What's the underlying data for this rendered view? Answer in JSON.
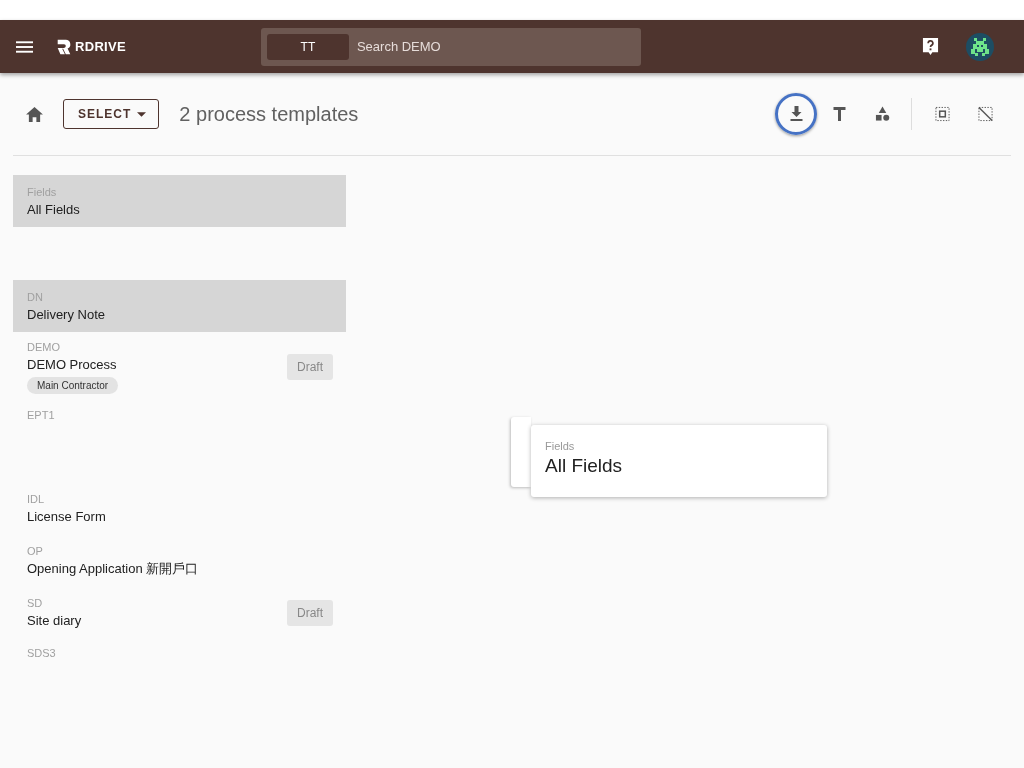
{
  "header": {
    "brand": "RDRIVE",
    "search": {
      "scope": "TT",
      "placeholder": "Search DEMO"
    }
  },
  "toolbar": {
    "select_label": "SELECT",
    "count_title": "2 process templates",
    "tools": [
      {
        "kind": "download",
        "selected": true
      },
      {
        "kind": "text",
        "selected": false
      },
      {
        "kind": "shapes",
        "selected": false
      },
      {
        "kind": "divider"
      },
      {
        "kind": "select-all",
        "selected": false
      },
      {
        "kind": "deselect",
        "selected": false
      }
    ]
  },
  "templates": [
    {
      "kind": "item",
      "code": "Fields",
      "name": "All Fields",
      "selected": true
    },
    {
      "kind": "empty-slot"
    },
    {
      "kind": "item",
      "code": "DN",
      "name": "Delivery Note",
      "selected": true
    },
    {
      "kind": "item",
      "code": "DEMO",
      "name": "DEMO Process",
      "selected": false,
      "tag": "Main Contractor",
      "status": "Draft"
    },
    {
      "kind": "item",
      "code": "EPT1",
      "selected": false
    },
    {
      "kind": "empty-slot"
    },
    {
      "kind": "item",
      "code": "IDL",
      "name": "License Form",
      "selected": false
    },
    {
      "kind": "item",
      "code": "OP",
      "name": "Opening Application 新開戶口",
      "selected": false
    },
    {
      "kind": "item",
      "code": "SD",
      "name": "Site diary",
      "selected": false,
      "status": "Draft"
    },
    {
      "kind": "item",
      "code": "SDS3",
      "selected": false
    }
  ],
  "drag_cards": [
    {
      "code": "Fields",
      "name": "All Fields"
    }
  ]
}
